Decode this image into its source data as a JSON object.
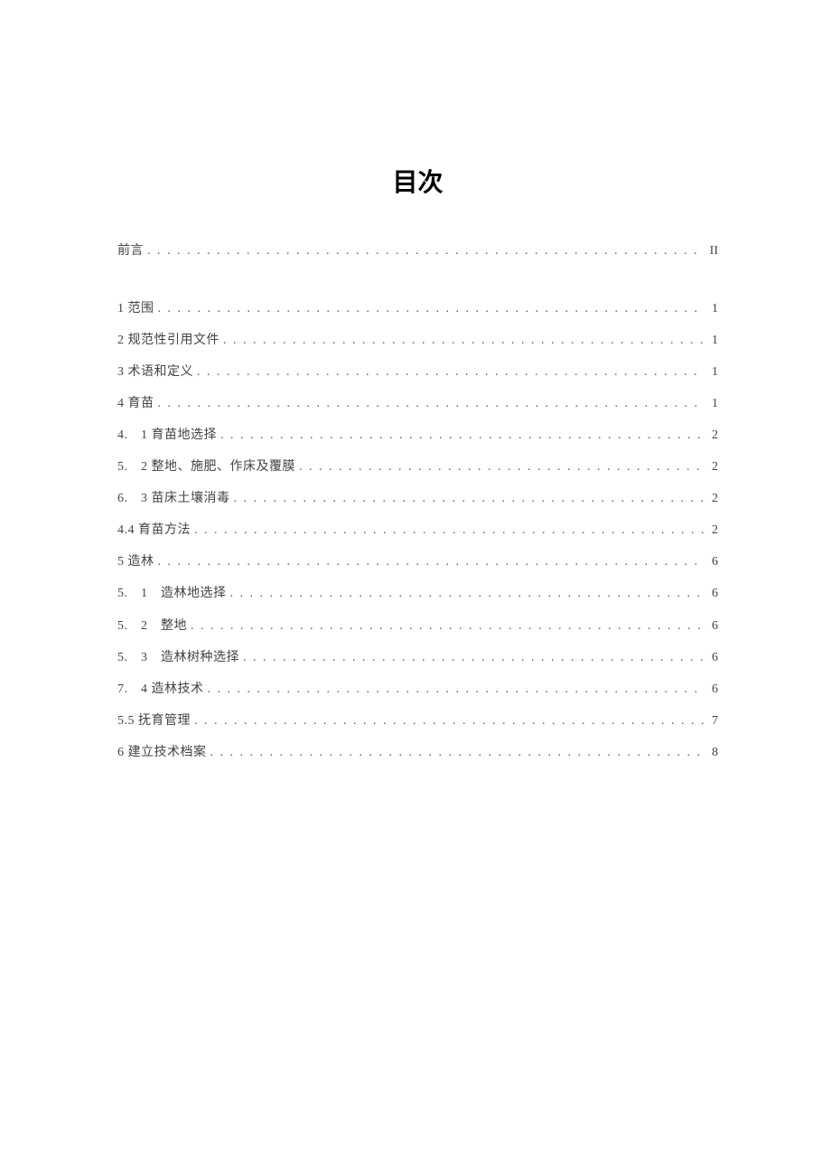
{
  "title": "目次",
  "entries": [
    {
      "label": "前言",
      "page": "II",
      "first": true
    },
    {
      "label": "1 范围",
      "page": "1"
    },
    {
      "label": "2 规范性引用文件",
      "page": "1"
    },
    {
      "label": "3 术语和定义",
      "page": "1"
    },
    {
      "label": "4 育苗",
      "page": "1"
    },
    {
      "label": "4.　1 育苗地选择",
      "page": "2"
    },
    {
      "label": "5.　2 整地、施肥、作床及覆膜",
      "page": "2"
    },
    {
      "label": "6.　3 苗床土壤消毒",
      "page": "2"
    },
    {
      "label": "4.4 育苗方法",
      "page": "2"
    },
    {
      "label": "5 造林",
      "page": "6"
    },
    {
      "label": "5.　1　造林地选择",
      "page": "6"
    },
    {
      "label": "5.　2　整地",
      "page": "6"
    },
    {
      "label": "5.　3　造林树种选择",
      "page": "6"
    },
    {
      "label": "7.　4 造林技术",
      "page": "6"
    },
    {
      "label": "5.5 抚育管理",
      "page": "7"
    },
    {
      "label": "6 建立技术档案",
      "page": "8"
    }
  ]
}
